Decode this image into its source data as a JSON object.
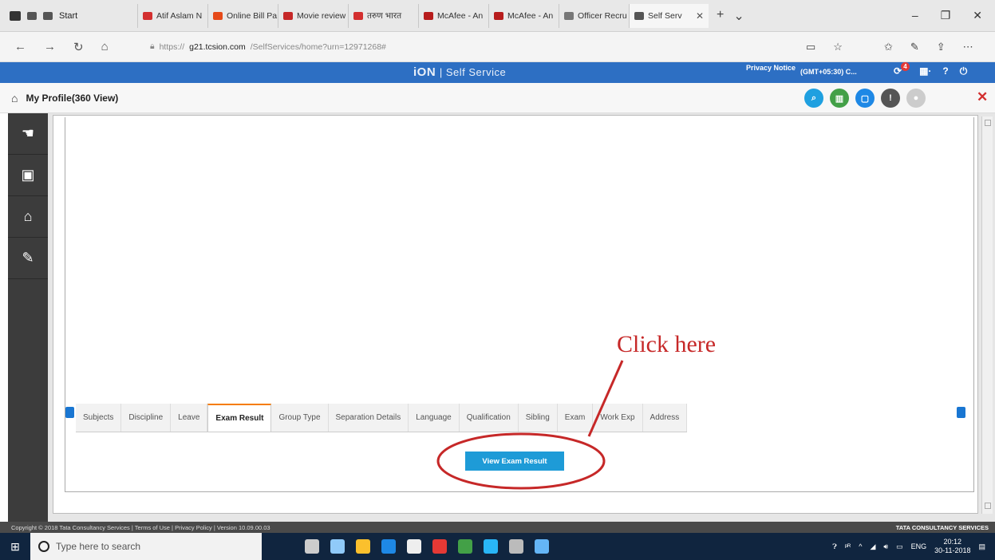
{
  "browser": {
    "start_label": "Start",
    "tabs": [
      {
        "label": "Atif Aslam N",
        "color": "#d32f2f"
      },
      {
        "label": "Online Bill Pa",
        "color": "#e64a19"
      },
      {
        "label": "Movie review",
        "color": "#c62828"
      },
      {
        "label": "तरुण भारत",
        "color": "#d32f2f"
      },
      {
        "label": "McAfee - An",
        "color": "#b71c1c"
      },
      {
        "label": "McAfee - An",
        "color": "#b71c1c"
      },
      {
        "label": "Officer Recru",
        "color": "#777777"
      },
      {
        "label": "Self Serv",
        "color": "#555555"
      }
    ],
    "url_prefix": "https://",
    "url_domain": "g21.tcsion.com",
    "url_path": "/SelfServices/home?urn=12971268#"
  },
  "header": {
    "brand": "iON",
    "brand_sub": "| Self Service",
    "privacy": "Privacy Notice",
    "timezone": "(GMT+05:30) C...",
    "notification_count": "4",
    "accent": "#2d6fc3"
  },
  "profile": {
    "title": "My Profile(360 View)"
  },
  "sidebar_icons": [
    "handshake-icon",
    "monitor-icon",
    "bank-icon",
    "book-pen-icon"
  ],
  "tabs": [
    {
      "label": "Subjects",
      "active": false
    },
    {
      "label": "Discipline",
      "active": false
    },
    {
      "label": "Leave",
      "active": false
    },
    {
      "label": "Exam Result",
      "active": true
    },
    {
      "label": "Group Type",
      "active": false
    },
    {
      "label": "Separation Details",
      "active": false
    },
    {
      "label": "Language",
      "active": false
    },
    {
      "label": "Qualification",
      "active": false
    },
    {
      "label": "Sibling",
      "active": false
    },
    {
      "label": "Exam",
      "active": false
    },
    {
      "label": "Work Exp",
      "active": false
    },
    {
      "label": "Address",
      "active": false
    }
  ],
  "view_button": "View Exam Result",
  "annotation": "Click here",
  "footer": {
    "copyright": "Copyright © 2018 Tata Consultancy Services | Terms of Use | Privacy Policy | Version 10.09.00.03",
    "company": "TATA CONSULTANCY SERVICES"
  },
  "taskbar": {
    "search_placeholder": "Type here to search",
    "lang": "ENG",
    "time": "20:12",
    "date": "30-11-2018"
  }
}
